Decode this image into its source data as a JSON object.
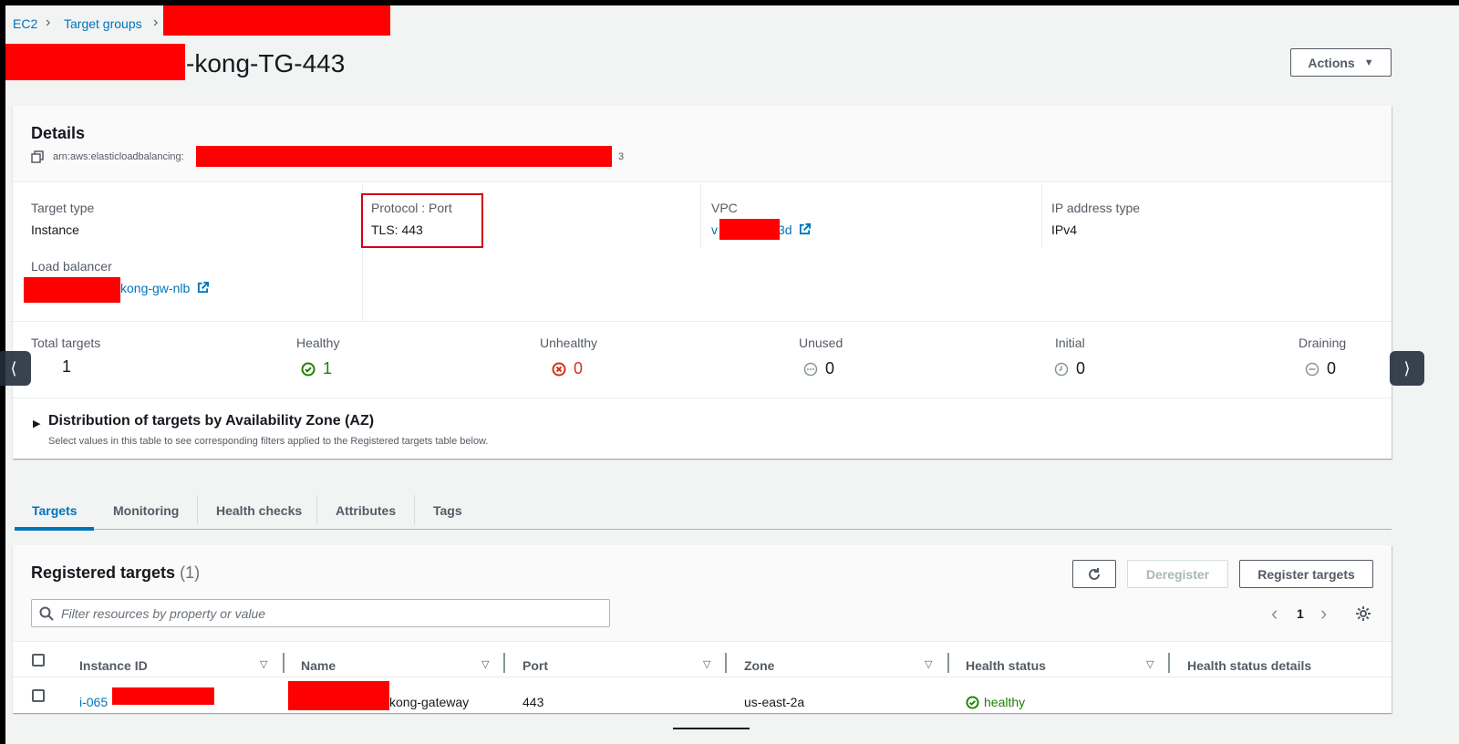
{
  "breadcrumb": {
    "ec2": "EC2",
    "target_groups": "Target groups"
  },
  "page": {
    "title_suffix": "-kong-TG-443",
    "actions_label": "Actions"
  },
  "details": {
    "heading": "Details",
    "arn_prefix": "arn:aws:elasticloadbalancing:",
    "arn_suffix": "3",
    "target_type_label": "Target type",
    "target_type_value": "Instance",
    "protocol_label": "Protocol : Port",
    "protocol_value": "TLS: 443",
    "vpc_label": "VPC",
    "vpc_prefix": "v",
    "vpc_suffix": "3d",
    "ip_type_label": "IP address type",
    "ip_type_value": "IPv4",
    "lb_label": "Load balancer",
    "lb_suffix": "kong-gw-nlb"
  },
  "counts": [
    {
      "label": "Total targets",
      "value": "1",
      "icon": "none"
    },
    {
      "label": "Healthy",
      "value": "1",
      "icon": "check-circle"
    },
    {
      "label": "Unhealthy",
      "value": "0",
      "icon": "x-circle"
    },
    {
      "label": "Unused",
      "value": "0",
      "icon": "dots-circle"
    },
    {
      "label": "Initial",
      "value": "0",
      "icon": "clock-circle"
    },
    {
      "label": "Draining",
      "value": "0",
      "icon": "minus-circle"
    }
  ],
  "distribution": {
    "title": "Distribution of targets by Availability Zone (AZ)",
    "subtitle": "Select values in this table to see corresponding filters applied to the Registered targets table below."
  },
  "tabs": [
    "Targets",
    "Monitoring",
    "Health checks",
    "Attributes",
    "Tags"
  ],
  "registered": {
    "title": "Registered targets",
    "count": "(1)",
    "deregister_label": "Deregister",
    "register_label": "Register targets",
    "filter_placeholder": "Filter resources by property or value",
    "page_number": "1",
    "columns": [
      "Instance ID",
      "Name",
      "Port",
      "Zone",
      "Health status",
      "Health status details"
    ],
    "rows": [
      {
        "instance_prefix": "i-065",
        "name_suffix": "kong-gateway",
        "port": "443",
        "zone": "us-east-2a",
        "health": "healthy",
        "health_details": ""
      }
    ]
  },
  "colors": {
    "link": "#0073bb",
    "healthy": "#1d8102",
    "unhealthy": "#d13212",
    "redaction": "#ff0000",
    "highlight_border": "#d0021b"
  }
}
